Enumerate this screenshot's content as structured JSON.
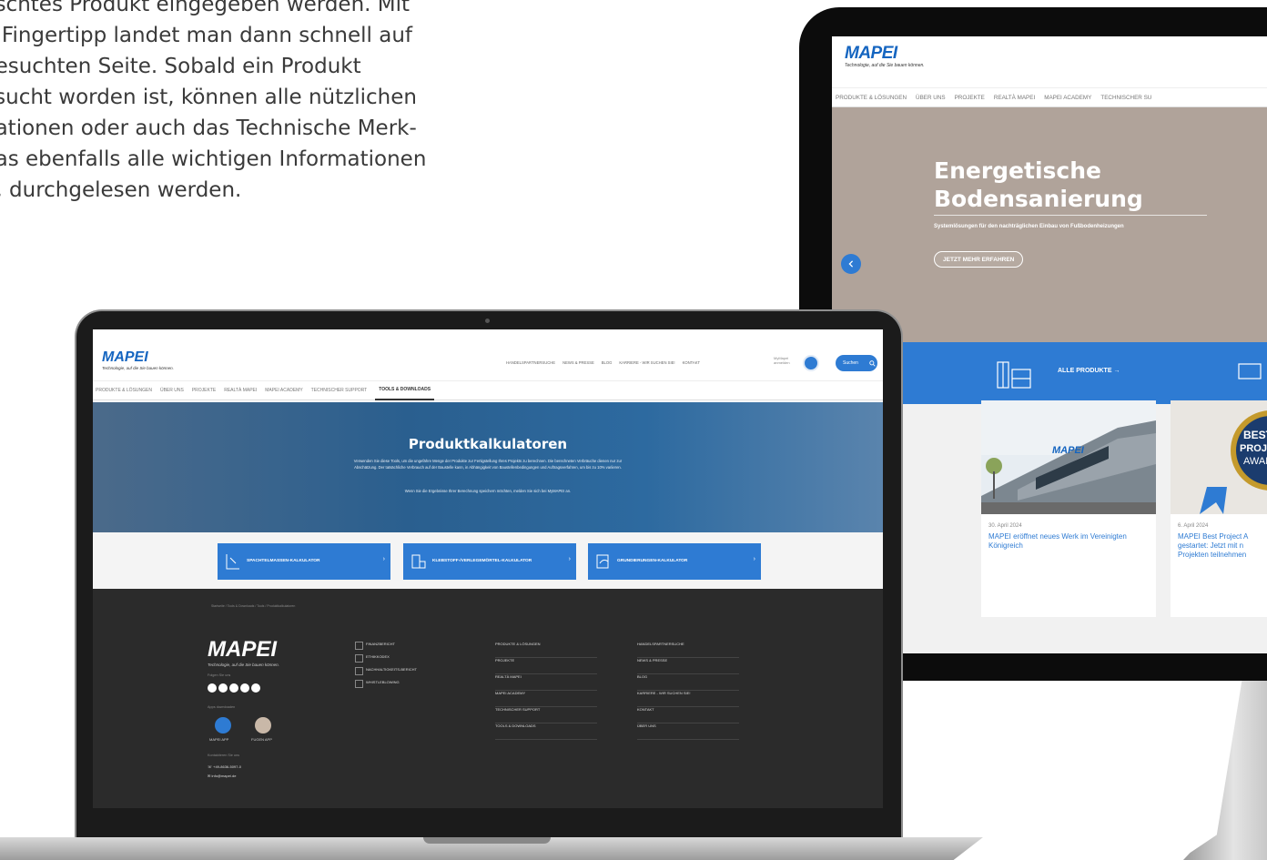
{
  "paragraph": {
    "lines": [
      "nschtes Produkt eingegeben werden. Mit",
      "n Fingertipp landet man dann schnell auf",
      "gesuchten Seite. Sobald ein Produkt",
      "esucht worden ist, können alle nützlichen",
      "nationen oder auch das Technische Merk-",
      "das ebenfalls alle wichtigen Informationen",
      "lt, durchgelesen werden."
    ]
  },
  "monitor": {
    "logo": "MAPEI",
    "tagline": "Technologie, auf die Sie bauen können.",
    "nav": [
      "PRODUKTE & LÖSUNGEN",
      "ÜBER UNS",
      "PROJEKTE",
      "REALTÀ MAPEI",
      "MAPEI ACADEMY",
      "TECHNISCHER SU"
    ],
    "hero": {
      "title_line1": "Energetische",
      "title_line2": "Bodensanierung",
      "subtitle": "Systemlösungen für den nachträglichen Einbau von Fußbodenheizungen",
      "cta": "JETZT MEHR ERFAHREN"
    },
    "all_products": "ALLE PRODUKTE →",
    "news": [
      {
        "date": "30. April 2024",
        "title": "MAPEI eröffnet neues Werk im Vereinigten Königreich"
      },
      {
        "date": "6. April 2024",
        "title": "MAPEI Best Project A gestartet: Jetzt mit n Projekten teilnehmen"
      }
    ],
    "award": {
      "line1": "BEST",
      "line2": "PROJEC",
      "line3": "AWAR"
    },
    "building_sign": "MAPEI"
  },
  "laptop": {
    "logo": "MAPEI",
    "tagline": "Technologie, auf die Sie bauen können.",
    "top_nav": [
      "HANDELSPARTNERSUCHE",
      "NEWS & PRESSE",
      "BLOG",
      "KARRIERE - WIR SUCHEN SIE!",
      "KONTAKT"
    ],
    "mymapei": "MyMapei anmelden",
    "search": "Suchen",
    "nav": [
      "PRODUKTE & LÖSUNGEN",
      "ÜBER UNS",
      "PROJEKTE",
      "REALTÀ MAPEI",
      "MAPEI ACADEMY",
      "TECHNISCHER SUPPORT"
    ],
    "nav_active": "TOOLS & DOWNLOADS",
    "hero": {
      "title": "Produktkalkulatoren",
      "desc": "Verwenden Sie diese Tools, um die ungefähre Menge der Produkte zur Fertigstellung Ihres Projekts zu berechnen. Die berechneten Verbräuche dienen nur zur Abschätzung. Der tatsächliche Verbrauch auf der Baustelle kann, in Abhängigkeit von Baustellenbedingungen und Auftragsverfahren, um bis zu 10% variieren.",
      "login_note": "Wenn Sie die Ergebnisse Ihrer Berechnung speichern möchten, melden Sie sich bei MyMAPEI an."
    },
    "calculators": [
      "SPACHTELMASSEN-KALKULATOR",
      "KLEBSTOFF-/VERLEGEMÖRTEL-KALKULATOR",
      "GRUNDIERUNGEN-KALKULATOR"
    ],
    "breadcrumb": "Startseite / Tools & Downloads / Tools / Produktkalkulatoren",
    "footer": {
      "logo": "MAPEI",
      "tagline": "Technologie, auf die Sie bauen können.",
      "follow": "Folgen Sie uns",
      "apps_label": "Apps downloaden",
      "apps": [
        "MAPEI APP",
        "FUGEN APP"
      ],
      "contact_label": "Kontaktieren Sie uns",
      "phone": "+49-8636-5097-0",
      "email": "info@mapei.de",
      "col1": [
        "FINANZBERICHT",
        "ETHIKKODEX",
        "NACHHALTIGKEITS-BERICHT",
        "WHISTLEBLOWING"
      ],
      "col2": [
        "PRODUKTE & LÖSUNGEN",
        "PROJEKTE",
        "REALTÀ MAPEI",
        "MAPEI ACADEMY",
        "TECHNISCHER SUPPORT",
        "TOOLS & DOWNLOADS"
      ],
      "col3": [
        "HANDELSPARTNERSUCHE",
        "NEWS & PRESSE",
        "BLOG",
        "KARRIERE - WIR SUCHEN SIE!",
        "KONTAKT",
        "ÜBER UNS"
      ]
    }
  }
}
